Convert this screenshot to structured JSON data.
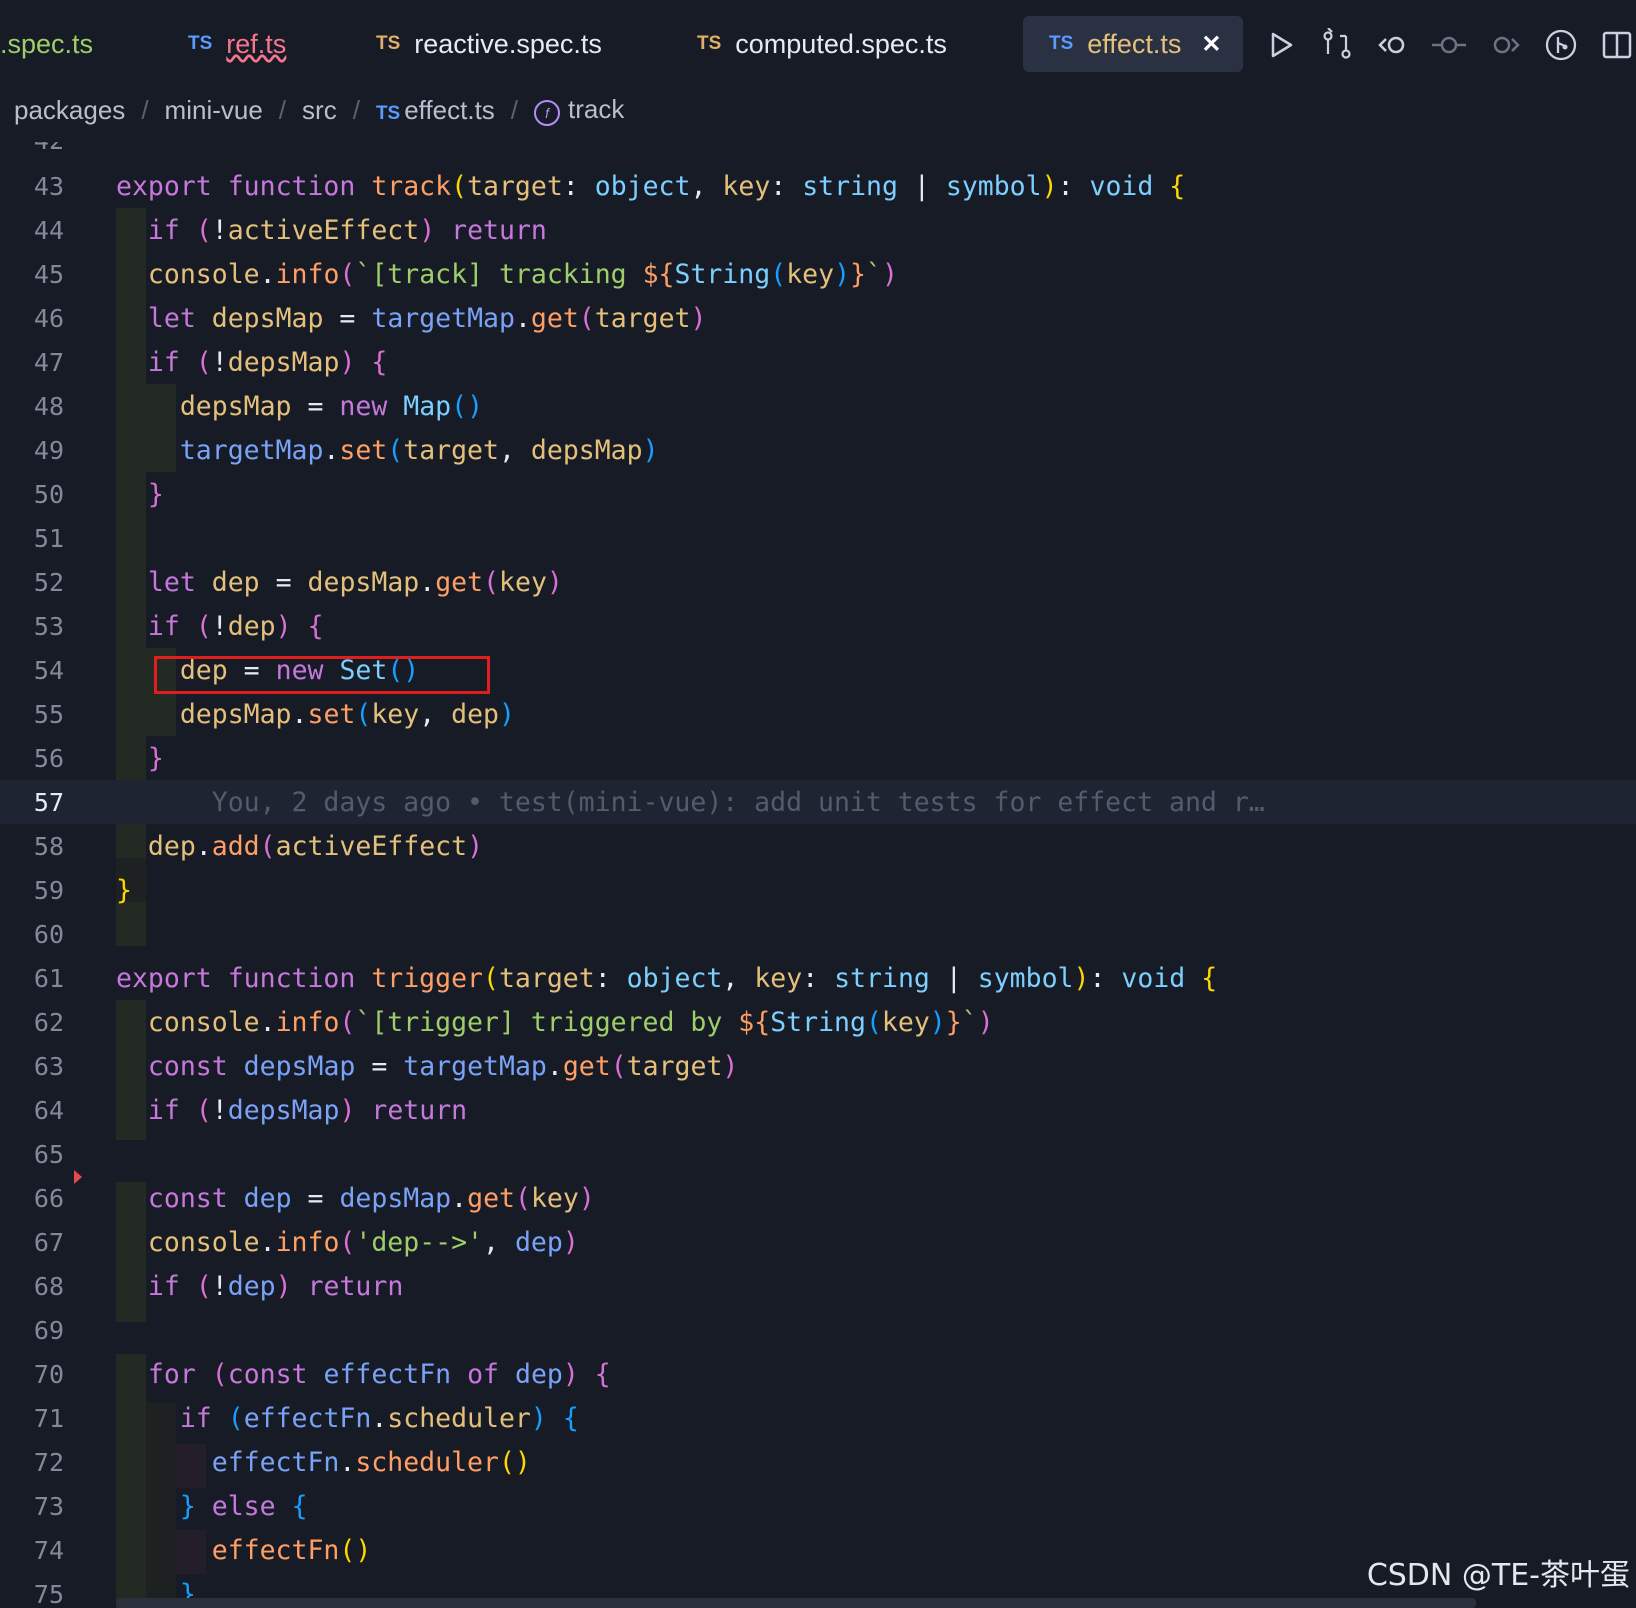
{
  "tabs": [
    {
      "label": ".spec.ts",
      "icon": "",
      "state": "normal"
    },
    {
      "label": "ref.ts",
      "icon": "TS",
      "state": "error"
    },
    {
      "label": "reactive.spec.ts",
      "icon": "TS",
      "state": "normal"
    },
    {
      "label": "computed.spec.ts",
      "icon": "TS",
      "state": "normal"
    },
    {
      "label": "effect.ts",
      "icon": "TS",
      "state": "active",
      "close": "✕"
    }
  ],
  "toolbar_icons": [
    "run-icon",
    "compare-icon",
    "go-back-icon",
    "commit-icon",
    "go-forward-icon",
    "git-graph-icon",
    "split-editor-icon"
  ],
  "breadcrumb": {
    "items": [
      "packages",
      "mini-vue",
      "src",
      "effect.ts",
      "track"
    ],
    "file_icon": "TS",
    "symbol_icon": "f"
  },
  "editor": {
    "first_line_partial": "42",
    "current_line": "57",
    "blame": "You, 2 days ago • test(mini-vue): add unit tests for effect and r…",
    "line_numbers": [
      "43",
      "44",
      "45",
      "46",
      "47",
      "48",
      "49",
      "50",
      "51",
      "52",
      "53",
      "54",
      "55",
      "56",
      "57",
      "58",
      "59",
      "60",
      "61",
      "62",
      "63",
      "64",
      "65",
      "66",
      "67",
      "68",
      "69",
      "70",
      "71",
      "72",
      "73",
      "74",
      "75"
    ]
  },
  "watermark": "CSDN @TE-茶叶蛋",
  "colors": {
    "background": "#171b26",
    "highlight_box": "#e01e1e",
    "active_tab_label": "#e5c07b",
    "error_tab_label": "#f7768e"
  }
}
